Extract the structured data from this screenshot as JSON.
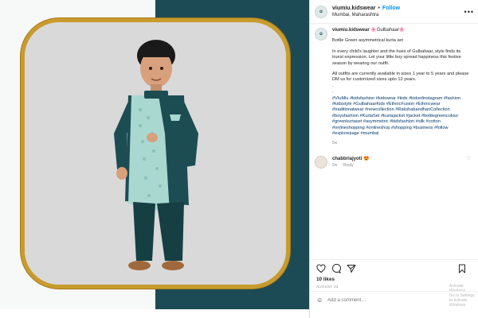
{
  "post": {
    "username": "viumiu.kidswear",
    "dot": "•",
    "follow_label": "Follow",
    "location": "Mumbai, Maharashtra",
    "more_label": "•••"
  },
  "caption": {
    "username": "viumiu.kidswear",
    "title_suffix": "🌸Gulbahaar🌸",
    "line1": "Bottle Green asymmetrical kurta set",
    "para1": "In every child's laughter and the hues of Gulbahaar, style finds its truest expression. Let your little boy spread happiness this festive season by wearing our outfit.",
    "para2": "All outfits are currently available in sizes 1 year to 5 years and please DM us for customized sizes upto 12 years.",
    "dots": ".\n.",
    "hashtags": "#VIuMiu #kidsfashion #kidswear #kids #kidsofinstagram #fashion #kidsstyle #GulbahaarKids #EthnicFusion #Ethnicwear #traditionalwear #newcollection #RakshabandhanCollection #boysfashion #KurtaSet #kurtajacket #jacket #bottlegreencolour #greenkurtaset #asymmetric #kidsfashion #silk #cotton #onlineshopping #onlineshop #shopping #business #follow #explorepage #mumbai",
    "time": "5w"
  },
  "comment": {
    "username": "chabbriajyoti",
    "text": "😍",
    "time": "5w",
    "reply_label": "Reply"
  },
  "actions": {
    "likes": "10 likes",
    "date": "AUGUST 23",
    "comment_placeholder": "Add a comment…",
    "emoji_icon": "☺"
  },
  "watermark": {
    "line1": "Activate Windows",
    "line2": "Go to Settings to activate Windows."
  },
  "colors": {
    "teal_background": "#1d4b55",
    "gold_frame": "#c89b2e",
    "kurta_green": "#1c4d52",
    "mint_print": "#a9d8d1",
    "link_blue": "#0095f6",
    "hashtag_blue": "#00376b"
  }
}
